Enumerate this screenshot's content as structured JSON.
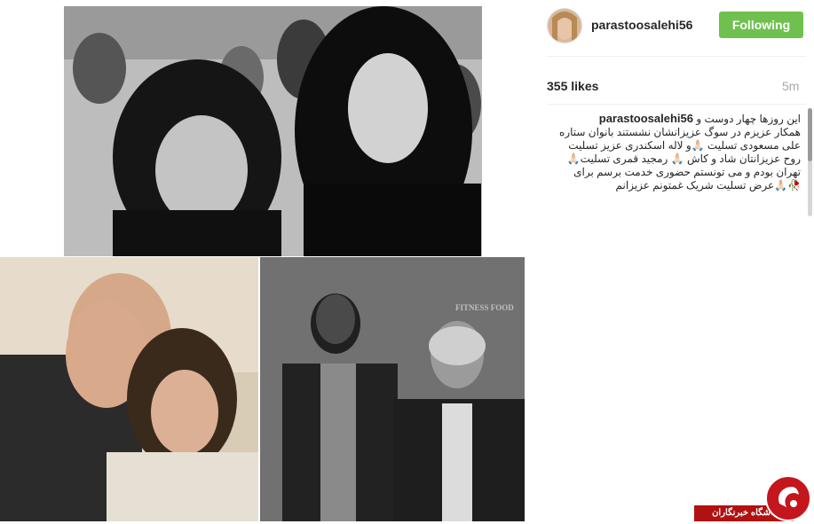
{
  "post": {
    "username": "parastoosalehi56",
    "follow_label": "Following",
    "likes": "355 likes",
    "time": "5m",
    "caption_user": "parastoosalehi56",
    "caption_lines": [
      "این روزها چهار دوست و",
      "همکار عزیزم در سوگ عزیزانشان نشستند بانوان ستاره",
      "علی مسعودی تسلیت 🙏🏻و لاله اسکندری عزیز تسلیت",
      "روح عزیزانتان شاد و کاش 🙏🏻 رمجید قمری تسلیت🙏🏻",
      "تهران بودم و می تونستم حضوری خدمت برسم برای",
      "🥀🙏🏻عرض تسلیت شریک غمتونم عزیزانم"
    ]
  },
  "watermark": {
    "label": "باشگاه خبرنگاران"
  },
  "photos": {
    "right_signage": "FITNESS FOOD"
  },
  "colors": {
    "follow_bg": "#70c050",
    "watermark_red": "#c4161c"
  }
}
